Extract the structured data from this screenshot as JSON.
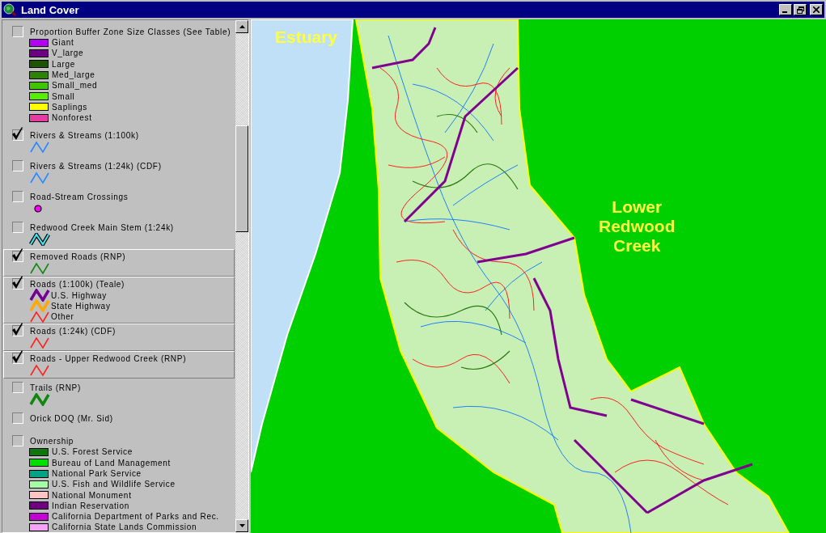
{
  "window": {
    "title": "Land Cover"
  },
  "legend": {
    "themes": [
      {
        "name": "Proportion Buffer Zone Size Classes (See Table)",
        "visible": false,
        "active": false,
        "kind": "classes",
        "classes": [
          {
            "label": "Giant",
            "kind": "fill",
            "color": "#b400f4"
          },
          {
            "label": "V_large",
            "kind": "fill",
            "color": "#6c0080"
          },
          {
            "label": "Large",
            "kind": "fill",
            "color": "#1c5400"
          },
          {
            "label": "Med_large",
            "kind": "fill",
            "color": "#2c8400"
          },
          {
            "label": "Small_med",
            "kind": "fill",
            "color": "#40c400"
          },
          {
            "label": "Small",
            "kind": "fill",
            "color": "#54f000"
          },
          {
            "label": "Saplings",
            "kind": "fill",
            "color": "#ffff00"
          },
          {
            "label": "Nonforest",
            "kind": "fill",
            "color": "#e43ca4"
          }
        ]
      },
      {
        "name": "Rivers & Streams (1:100k)",
        "visible": true,
        "active": false,
        "kind": "symbol",
        "symbol": {
          "kind": "line",
          "color": "#2888ff"
        }
      },
      {
        "name": "Rivers & Streams (1:24k) (CDF)",
        "visible": false,
        "active": false,
        "kind": "symbol",
        "symbol": {
          "kind": "line",
          "color": "#2888ff"
        }
      },
      {
        "name": "Road-Stream Crossings",
        "visible": false,
        "active": false,
        "kind": "symbol",
        "symbol": {
          "kind": "point",
          "color": "#ff00ff"
        }
      },
      {
        "name": "Redwood Creek Main Stem (1:24k)",
        "visible": false,
        "active": false,
        "kind": "symbol",
        "symbol": {
          "kind": "cased-line",
          "color": "#40e4f0"
        }
      },
      {
        "name": "Removed Roads (RNP)",
        "visible": true,
        "active": true,
        "kind": "symbol",
        "symbol": {
          "kind": "line",
          "color": "#108810"
        }
      },
      {
        "name": "Roads (1:100k) (Teale)",
        "visible": true,
        "active": true,
        "kind": "classes",
        "classes": [
          {
            "label": "U.S. Highway",
            "kind": "thick-line",
            "color": "#700090"
          },
          {
            "label": "State Highway",
            "kind": "thick-line",
            "color": "#ffa800"
          },
          {
            "label": "Other",
            "kind": "line",
            "color": "#ff2020"
          }
        ]
      },
      {
        "name": "Roads (1:24k) (CDF)",
        "visible": true,
        "active": true,
        "kind": "symbol",
        "symbol": {
          "kind": "line",
          "color": "#ff2020"
        }
      },
      {
        "name": "Roads - Upper Redwood Creek (RNP)",
        "visible": true,
        "active": true,
        "kind": "symbol",
        "symbol": {
          "kind": "line",
          "color": "#ff2020"
        }
      },
      {
        "name": "Trails (RNP)",
        "visible": false,
        "active": false,
        "kind": "symbol",
        "symbol": {
          "kind": "thick-line",
          "color": "#108810"
        }
      },
      {
        "name": "Orick DOQ (Mr. Sid)",
        "visible": false,
        "active": false,
        "kind": "plain"
      },
      {
        "name": "Ownership",
        "visible": false,
        "active": false,
        "kind": "classes",
        "classes": [
          {
            "label": "U.S. Forest Service",
            "kind": "fill",
            "color": "#0c780c"
          },
          {
            "label": "Bureau of Land Management",
            "kind": "fill",
            "color": "#00e000"
          },
          {
            "label": "National Park Service",
            "kind": "fill",
            "color": "#00a484"
          },
          {
            "label": "U.S. Fish and Wildlife Service",
            "kind": "fill",
            "color": "#a4ffa4"
          },
          {
            "label": "National Monument",
            "kind": "fill",
            "color": "#ffc4c4"
          },
          {
            "label": "Indian Reservation",
            "kind": "fill",
            "color": "#700080"
          },
          {
            "label": "California Department of Parks and Rec.",
            "kind": "fill",
            "color": "#c400d4"
          },
          {
            "label": "California State Lands Commission",
            "kind": "fill",
            "color": "#f4a4f4"
          }
        ]
      }
    ]
  },
  "map": {
    "labels": [
      {
        "text": "Estuary"
      },
      {
        "text": "Lower Redwood Creek"
      }
    ]
  }
}
